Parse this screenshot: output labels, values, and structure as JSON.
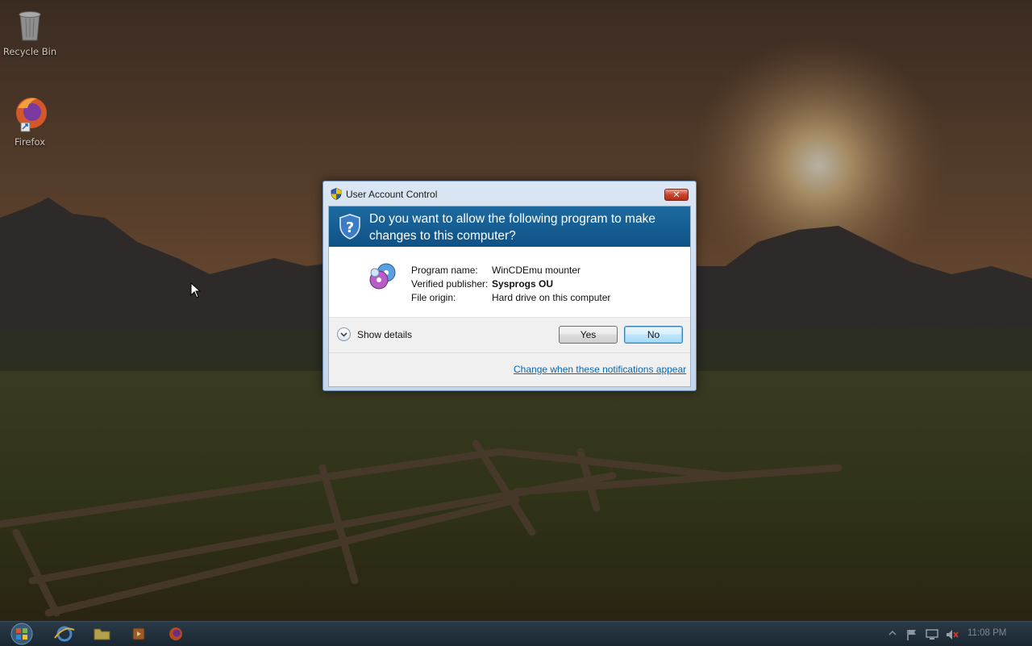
{
  "desktop": {
    "icons": [
      {
        "label": "Recycle Bin",
        "icon": "recycle-bin-icon"
      },
      {
        "label": "Firefox",
        "icon": "firefox-icon"
      }
    ]
  },
  "dialog": {
    "title": "User Account Control",
    "close_glyph": "✕",
    "question": "Do you want to allow the following program to make changes to this computer?",
    "program_icon": "disc-app-icon",
    "fields": {
      "program_name_label": "Program name:",
      "program_name": "WinCDEmu mounter",
      "publisher_label": "Verified publisher:",
      "publisher": "Sysprogs OU",
      "origin_label": "File origin:",
      "origin": "Hard drive on this computer"
    },
    "show_details": "Show details",
    "yes_label": "Yes",
    "no_label": "No",
    "change_link": "Change when these notifications appear",
    "colors": {
      "banner": "#11578c",
      "link": "#0a66b0"
    }
  },
  "taskbar": {
    "pinned": [
      "internet-explorer-icon",
      "windows-explorer-icon",
      "media-player-icon",
      "firefox-icon"
    ],
    "tray": [
      "show-hidden-icons-arrow",
      "action-center-flag-icon",
      "network-icon",
      "volume-muted-icon"
    ],
    "clock": "11:08 PM"
  }
}
